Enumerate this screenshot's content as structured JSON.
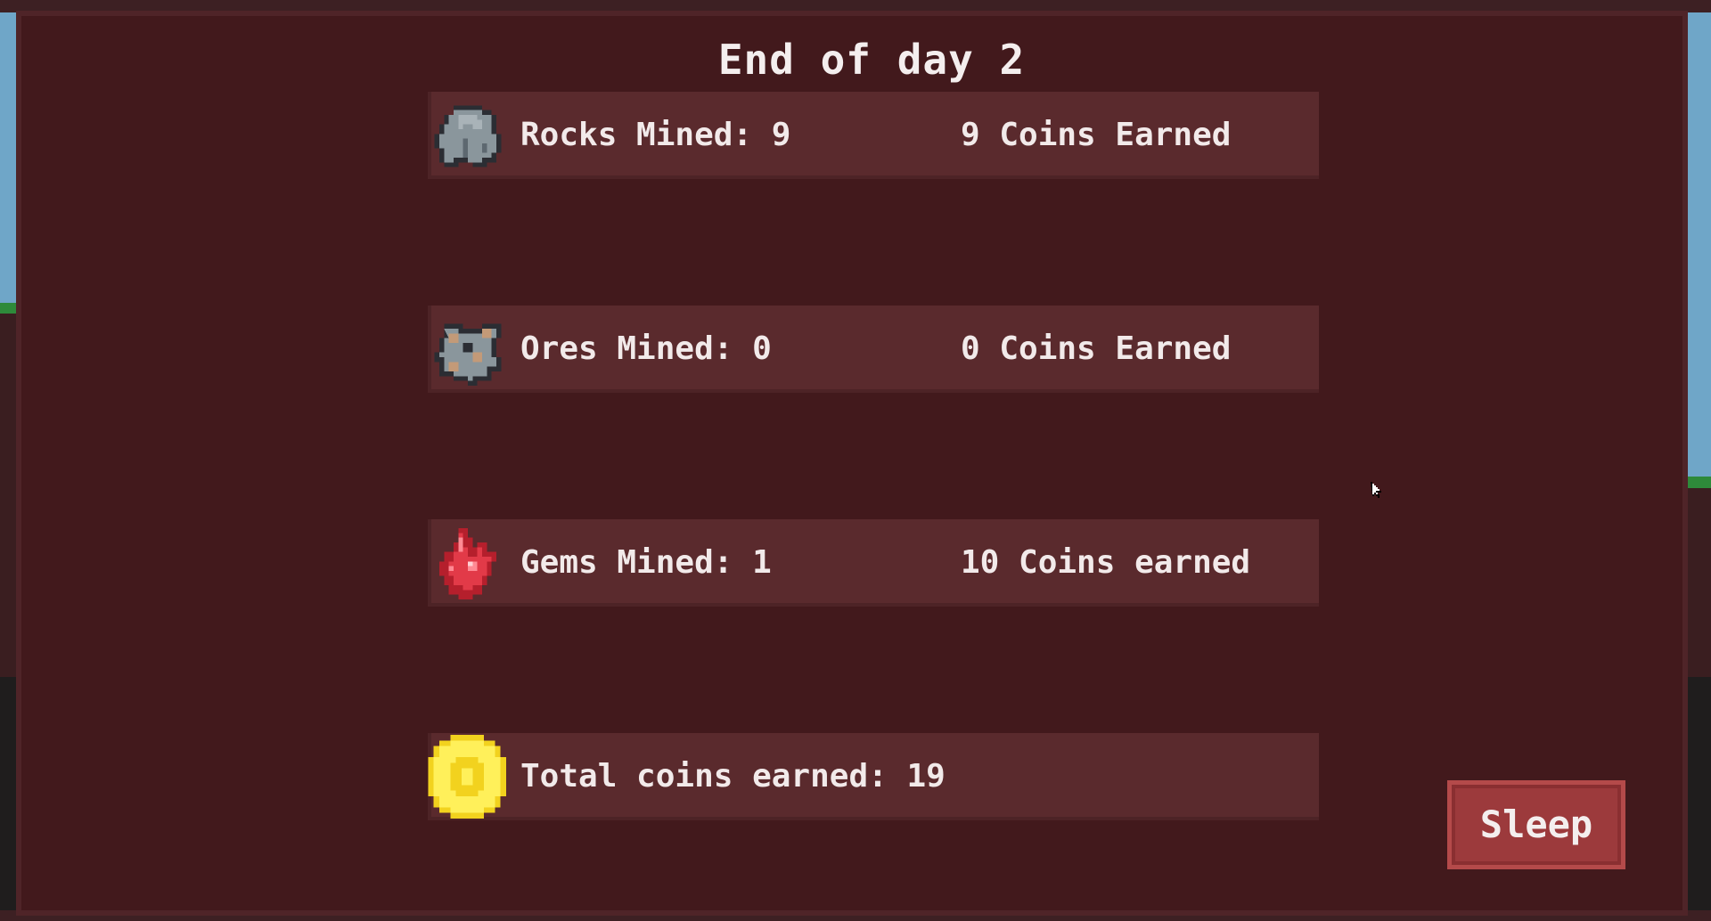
{
  "screen": {
    "title": "End of day 2"
  },
  "rows": [
    {
      "icon": "rock-icon",
      "label": "Rocks Mined: 9",
      "coins": "9 Coins Earned"
    },
    {
      "icon": "ore-icon",
      "label": "Ores Mined: 0",
      "coins": "0 Coins Earned"
    },
    {
      "icon": "gem-icon",
      "label": "Gems Mined: 1",
      "coins": "10 Coins earned"
    },
    {
      "icon": "coin-icon",
      "label": "Total coins earned: 19",
      "coins": ""
    }
  ],
  "actions": {
    "sleep_label": "Sleep"
  },
  "colors": {
    "panel": "#42191c",
    "row": "#5a2a2d",
    "button": "#9c3a3c",
    "text": "#f2eaea"
  }
}
